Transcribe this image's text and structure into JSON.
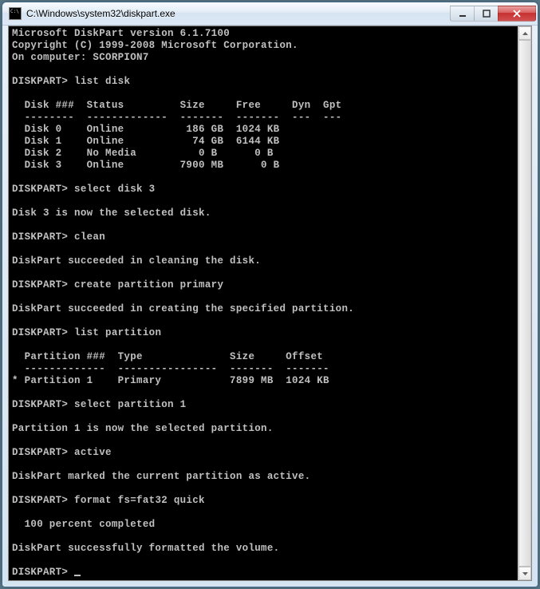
{
  "window": {
    "title": "C:\\Windows\\system32\\diskpart.exe"
  },
  "header": {
    "line1": "Microsoft DiskPart version 6.1.7100",
    "line2": "Copyright (C) 1999-2008 Microsoft Corporation.",
    "line3": "On computer: SCORPION7"
  },
  "prompt": "DISKPART>",
  "commands": {
    "c1": "list disk",
    "c2": "select disk 3",
    "c3": "clean",
    "c4": "create partition primary",
    "c5": "list partition",
    "c6": "select partition 1",
    "c7": "active",
    "c8": "format fs=fat32 quick"
  },
  "disk_table": {
    "hdr": "  Disk ###  Status         Size     Free     Dyn  Gpt",
    "rule": "  --------  -------------  -------  -------  ---  ---",
    "r0": "  Disk 0    Online          186 GB  1024 KB",
    "r1": "  Disk 1    Online           74 GB  6144 KB",
    "r2": "  Disk 2    No Media          0 B      0 B",
    "r3": "  Disk 3    Online         7900 MB      0 B"
  },
  "responses": {
    "sel_disk": "Disk 3 is now the selected disk.",
    "clean": "DiskPart succeeded in cleaning the disk.",
    "create": "DiskPart succeeded in creating the specified partition.",
    "sel_part": "Partition 1 is now the selected partition.",
    "active": "DiskPart marked the current partition as active.",
    "progress": "  100 percent completed",
    "format": "DiskPart successfully formatted the volume."
  },
  "part_table": {
    "hdr": "  Partition ###  Type              Size     Offset",
    "rule": "  -------------  ----------------  -------  -------",
    "r0": "* Partition 1    Primary           7899 MB  1024 KB"
  }
}
